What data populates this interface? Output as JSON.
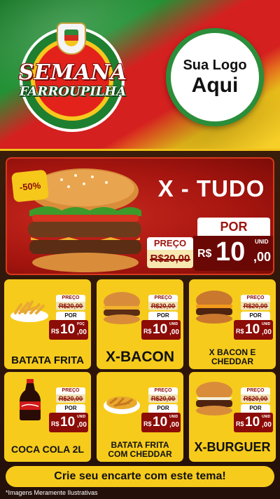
{
  "header": {
    "event_title_line1": "SEMANA",
    "event_title_line2": "FARROUPILHA",
    "logo_placeholder_line1": "Sua Logo",
    "logo_placeholder_line2": "Aqui"
  },
  "featured": {
    "badge": "-50%",
    "name": "X - TUDO",
    "preco_label": "PREÇO",
    "old_price": "R$20,00",
    "por_label": "POR",
    "currency": "R$",
    "price_int": "10",
    "price_cents": ",00",
    "unit": "UNID"
  },
  "products": [
    {
      "name": "BATATA FRITA",
      "preco_label": "PREÇO",
      "old_price": "R$20,00",
      "por_label": "POR",
      "currency": "R$",
      "price_int": "10",
      "price_cents": ",00",
      "unit": "POÇ",
      "icon": "fries-icon"
    },
    {
      "name": "X-BACON",
      "preco_label": "PREÇO",
      "old_price": "R$20,00",
      "por_label": "POR",
      "currency": "R$",
      "price_int": "10",
      "price_cents": ",00",
      "unit": "UNID",
      "icon": "burger-icon"
    },
    {
      "name": "X BACON E CHEDDAR",
      "preco_label": "PREÇO",
      "old_price": "R$20,00",
      "por_label": "POR",
      "currency": "R$",
      "price_int": "10",
      "price_cents": ",00",
      "unit": "UNID",
      "icon": "burger-icon"
    },
    {
      "name": "COCA COLA 2L",
      "preco_label": "PREÇO",
      "old_price": "R$20,00",
      "por_label": "POR",
      "currency": "R$",
      "price_int": "10",
      "price_cents": ",00",
      "unit": "UNID",
      "icon": "soda-bottle-icon"
    },
    {
      "name": "BATATA FRITA COM CHEDDAR",
      "preco_label": "PREÇO",
      "old_price": "R$20,00",
      "por_label": "POR",
      "currency": "R$",
      "price_int": "10",
      "price_cents": ",00",
      "unit": "UNID",
      "icon": "fries-cheddar-icon"
    },
    {
      "name": "X-BURGUER",
      "preco_label": "PREÇO",
      "old_price": "R$20,00",
      "por_label": "POR",
      "currency": "R$",
      "price_int": "10",
      "price_cents": ",00",
      "unit": "UNID",
      "icon": "burger-icon"
    }
  ],
  "cta": "Crie seu encarte com este tema!",
  "disclaimer": "*Imagens Meramente Ilustrativas",
  "colors": {
    "flag_green": "#239236",
    "flag_red": "#d52020",
    "flag_yellow": "#f6d02a",
    "card_yellow": "#f6cb1c",
    "price_red": "#8c0c08"
  }
}
